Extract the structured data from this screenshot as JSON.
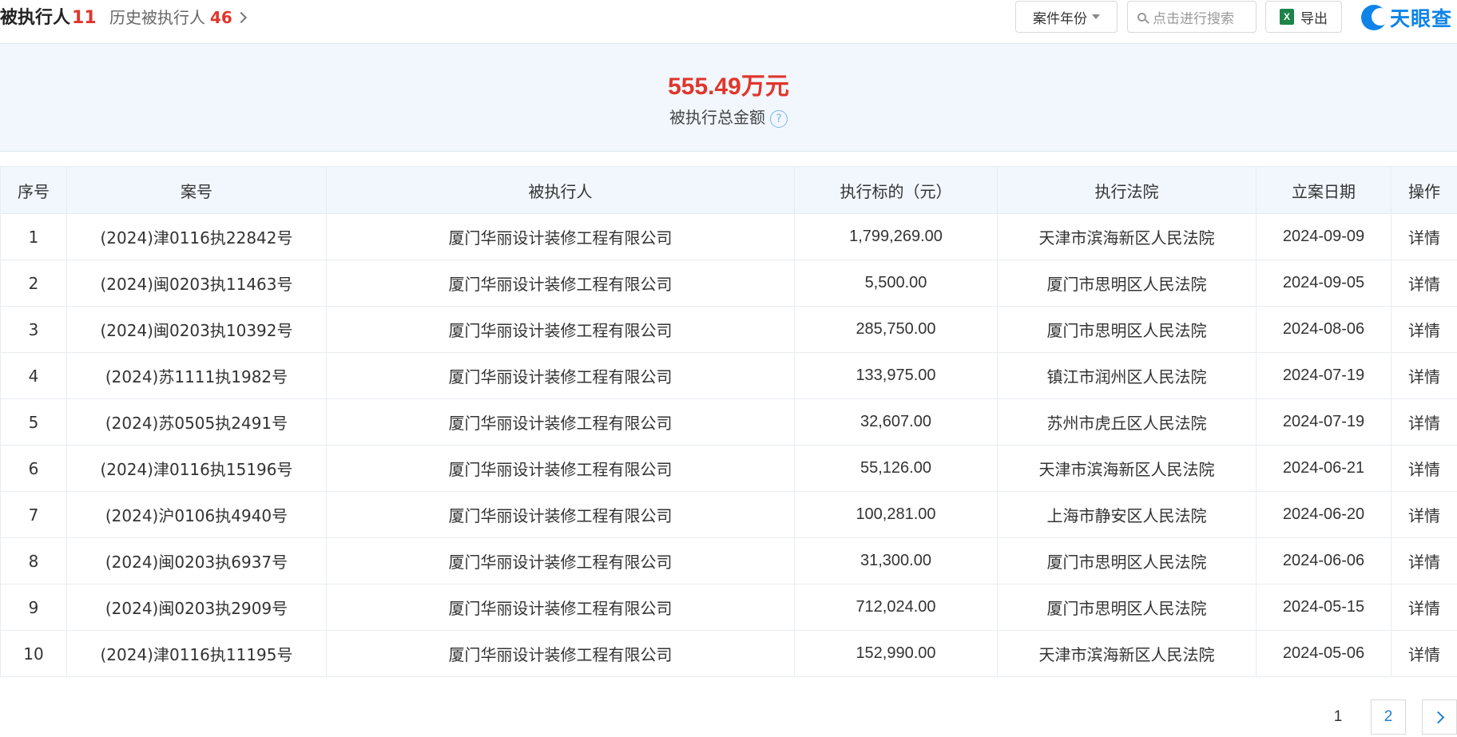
{
  "header": {
    "title": "被执行人",
    "title_count": "11",
    "history_label": "历史被执行人",
    "history_count": "46",
    "year_filter_label": "案件年份",
    "search_placeholder": "点击进行搜索",
    "export_label": "导出",
    "export_icon_text": "X",
    "brand_name": "天眼查"
  },
  "summary": {
    "amount": "555.49万元",
    "label": "被执行总金额",
    "help_glyph": "?"
  },
  "table": {
    "columns": [
      "序号",
      "案号",
      "被执行人",
      "执行标的（元）",
      "执行法院",
      "立案日期",
      "操作"
    ],
    "rows": [
      {
        "index": "1",
        "case_no": "(2024)津0116执22842号",
        "party": "厦门华丽设计装修工程有限公司",
        "amount": "1,799,269.00",
        "court": "天津市滨海新区人民法院",
        "date": "2024-09-09",
        "action": "详情"
      },
      {
        "index": "2",
        "case_no": "(2024)闽0203执11463号",
        "party": "厦门华丽设计装修工程有限公司",
        "amount": "5,500.00",
        "court": "厦门市思明区人民法院",
        "date": "2024-09-05",
        "action": "详情"
      },
      {
        "index": "3",
        "case_no": "(2024)闽0203执10392号",
        "party": "厦门华丽设计装修工程有限公司",
        "amount": "285,750.00",
        "court": "厦门市思明区人民法院",
        "date": "2024-08-06",
        "action": "详情"
      },
      {
        "index": "4",
        "case_no": "(2024)苏1111执1982号",
        "party": "厦门华丽设计装修工程有限公司",
        "amount": "133,975.00",
        "court": "镇江市润州区人民法院",
        "date": "2024-07-19",
        "action": "详情"
      },
      {
        "index": "5",
        "case_no": "(2024)苏0505执2491号",
        "party": "厦门华丽设计装修工程有限公司",
        "amount": "32,607.00",
        "court": "苏州市虎丘区人民法院",
        "date": "2024-07-19",
        "action": "详情"
      },
      {
        "index": "6",
        "case_no": "(2024)津0116执15196号",
        "party": "厦门华丽设计装修工程有限公司",
        "amount": "55,126.00",
        "court": "天津市滨海新区人民法院",
        "date": "2024-06-21",
        "action": "详情"
      },
      {
        "index": "7",
        "case_no": "(2024)沪0106执4940号",
        "party": "厦门华丽设计装修工程有限公司",
        "amount": "100,281.00",
        "court": "上海市静安区人民法院",
        "date": "2024-06-20",
        "action": "详情"
      },
      {
        "index": "8",
        "case_no": "(2024)闽0203执6937号",
        "party": "厦门华丽设计装修工程有限公司",
        "amount": "31,300.00",
        "court": "厦门市思明区人民法院",
        "date": "2024-06-06",
        "action": "详情"
      },
      {
        "index": "9",
        "case_no": "(2024)闽0203执2909号",
        "party": "厦门华丽设计装修工程有限公司",
        "amount": "712,024.00",
        "court": "厦门市思明区人民法院",
        "date": "2024-05-15",
        "action": "详情"
      },
      {
        "index": "10",
        "case_no": "(2024)津0116执11195号",
        "party": "厦门华丽设计装修工程有限公司",
        "amount": "152,990.00",
        "court": "天津市滨海新区人民法院",
        "date": "2024-05-06",
        "action": "详情"
      }
    ]
  },
  "pagination": {
    "pages": [
      "1",
      "2"
    ],
    "current": "1"
  },
  "colors": {
    "accent_red": "#e0362c",
    "link_blue": "#1f7fd1",
    "brand_blue": "#0e84e8",
    "panel_bg": "#f1f7fd"
  }
}
